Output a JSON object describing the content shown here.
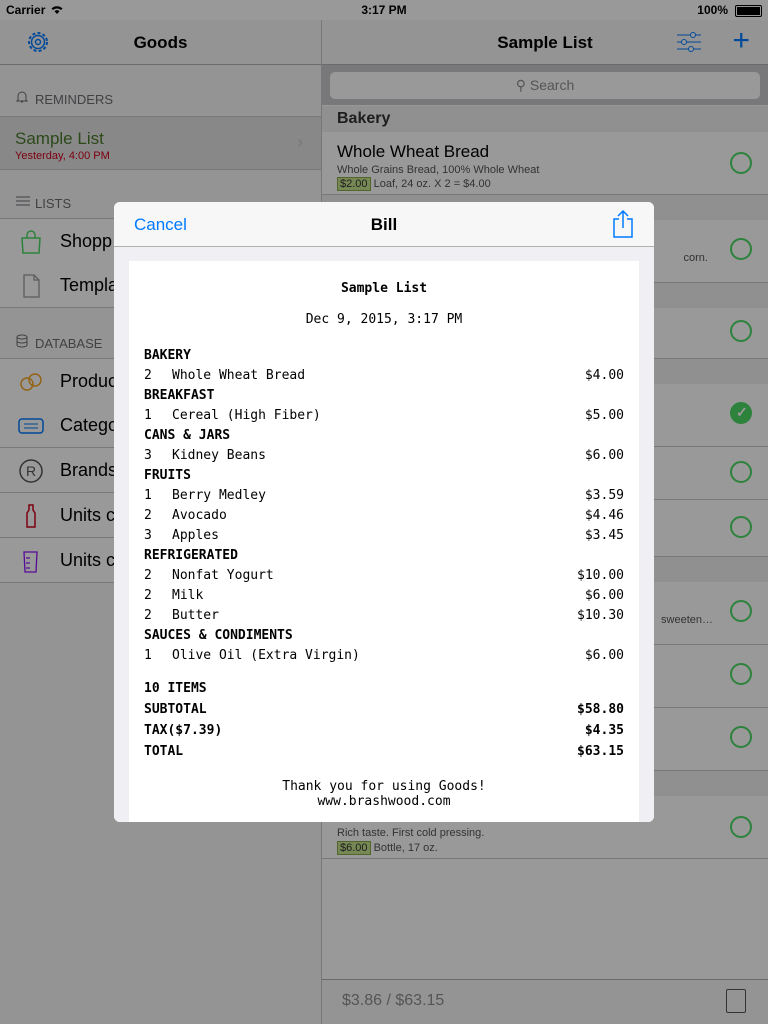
{
  "status_bar": {
    "carrier": "Carrier",
    "time": "3:17 PM",
    "battery": "100%"
  },
  "master": {
    "title": "Goods",
    "reminders_header": "REMINDERS",
    "reminder": {
      "title": "Sample List",
      "subtitle": "Yesterday, 4:00 PM"
    },
    "lists_header": "LISTS",
    "lists": [
      {
        "label": "Shopp"
      },
      {
        "label": "Templa"
      }
    ],
    "database_header": "DATABASE",
    "database": [
      {
        "label": "Produc"
      },
      {
        "label": "Catego"
      },
      {
        "label": "Brands"
      },
      {
        "label": "Units c"
      },
      {
        "label": "Units c"
      }
    ]
  },
  "detail": {
    "title": "Sample List",
    "search_placeholder": "Search",
    "section": "Bakery",
    "first_item": {
      "name": "Whole Wheat Bread",
      "desc": "Whole Grains Bread, 100% Whole Wheat",
      "price": "$2.00",
      "detail": "Loaf, 24 oz. X 2 = $4.00"
    },
    "peek_texts": {
      "a": "corn.",
      "b": "sweeten…"
    },
    "last_item": {
      "desc": "Rich taste. First cold pressing.",
      "price": "$6.00",
      "detail": "Bottle, 17 oz."
    },
    "footer_total": "$3.86 / $63.15"
  },
  "modal": {
    "cancel": "Cancel",
    "title": "Bill",
    "receipt": {
      "title": "Sample List",
      "date": "Dec 9, 2015, 3:17 PM",
      "categories": [
        {
          "name": "BAKERY",
          "items": [
            {
              "qty": "2",
              "name": "Whole Wheat Bread",
              "amount": "$4.00"
            }
          ]
        },
        {
          "name": "BREAKFAST",
          "items": [
            {
              "qty": "1",
              "name": "Cereal (High Fiber)",
              "amount": "$5.00"
            }
          ]
        },
        {
          "name": "CANS & JARS",
          "items": [
            {
              "qty": "3",
              "name": "Kidney Beans",
              "amount": "$6.00"
            }
          ]
        },
        {
          "name": "FRUITS",
          "items": [
            {
              "qty": "1",
              "name": "Berry Medley",
              "amount": "$3.59"
            },
            {
              "qty": "2",
              "name": "Avocado",
              "amount": "$4.46"
            },
            {
              "qty": "3",
              "name": "Apples",
              "amount": "$3.45"
            }
          ]
        },
        {
          "name": "REFRIGERATED",
          "items": [
            {
              "qty": "2",
              "name": "Nonfat Yogurt",
              "amount": "$10.00"
            },
            {
              "qty": "2",
              "name": "Milk",
              "amount": "$6.00"
            },
            {
              "qty": "2",
              "name": "Butter",
              "amount": "$10.30"
            }
          ]
        },
        {
          "name": "SAUCES & CONDIMENTS",
          "items": [
            {
              "qty": "1",
              "name": "Olive Oil (Extra Virgin)",
              "amount": "$6.00"
            }
          ]
        }
      ],
      "count": "10 ITEMS",
      "subtotal_label": "SUBTOTAL",
      "subtotal": "$58.80",
      "tax_label": "TAX($7.39)",
      "tax": "$4.35",
      "total_label": "TOTAL",
      "total": "$63.15",
      "thanks": "Thank you for using Goods!",
      "website": "www.brashwood.com"
    }
  },
  "colors": {
    "accent": "#007aff",
    "check": "#4cd964",
    "reminder_date": "#d0021b"
  }
}
